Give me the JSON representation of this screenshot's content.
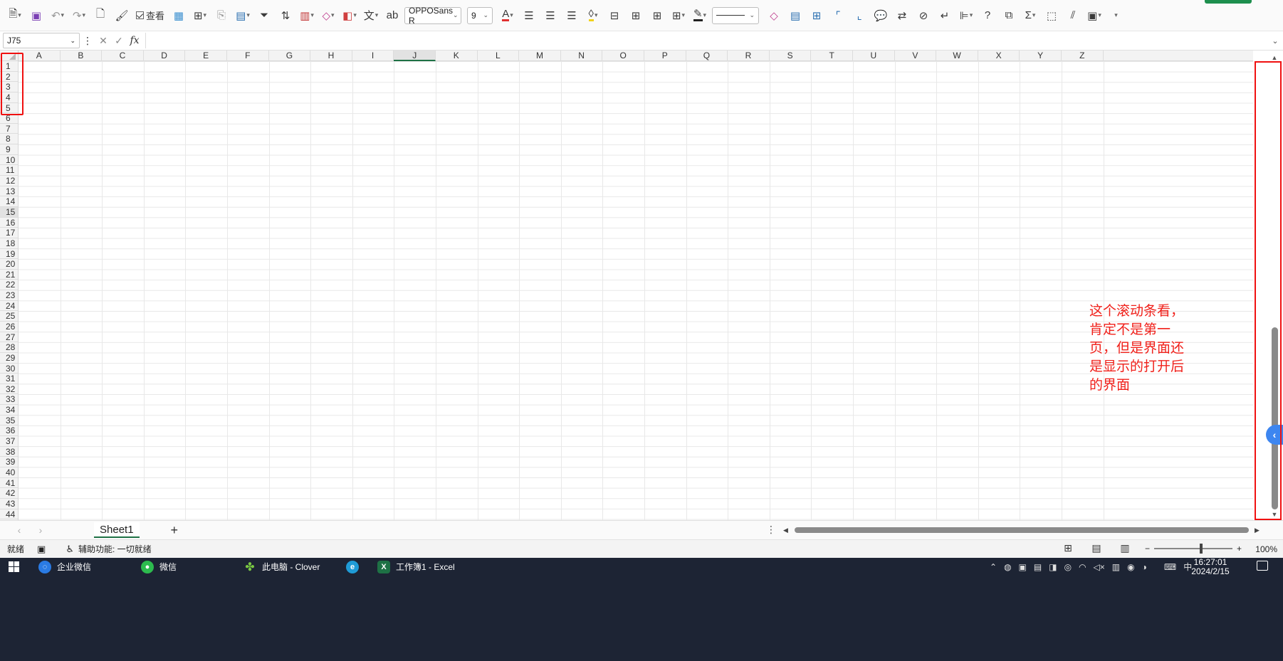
{
  "toolbar": {
    "check_view_label": "查看",
    "font_name": "OPPOSans R",
    "font_size": "9"
  },
  "formula_bar": {
    "name_box": "J75",
    "fx_label": "fx",
    "formula": ""
  },
  "grid": {
    "columns": [
      "A",
      "B",
      "C",
      "D",
      "E",
      "F",
      "G",
      "H",
      "I",
      "J",
      "K",
      "L",
      "M",
      "N",
      "O",
      "P",
      "Q",
      "R",
      "S",
      "T",
      "U",
      "V",
      "W",
      "X",
      "Y",
      "Z"
    ],
    "active_column": "J",
    "rows": [
      "1",
      "2",
      "3",
      "4",
      "5",
      "6",
      "7",
      "8",
      "9",
      "10",
      "11",
      "12",
      "13",
      "14",
      "15",
      "16",
      "17",
      "18",
      "19",
      "20",
      "21",
      "22",
      "23",
      "24",
      "25",
      "26",
      "27",
      "28",
      "29",
      "30",
      "31",
      "32",
      "33",
      "34",
      "35",
      "36",
      "37",
      "38",
      "39",
      "40",
      "41",
      "42",
      "43",
      "44"
    ],
    "active_row": "15"
  },
  "annotation": {
    "note_lines": [
      "这个滚动条看，",
      "肯定不是第一",
      "页，但是界面还",
      "是显示的打开后",
      "的界面"
    ],
    "color": "#f01010"
  },
  "sheets": {
    "tabs": [
      "Sheet1"
    ],
    "active": "Sheet1",
    "add_label": "+"
  },
  "status": {
    "ready": "就绪",
    "accessibility": "辅助功能: 一切就绪",
    "zoom_minus": "−",
    "zoom_plus": "+",
    "zoom_value": "100%"
  },
  "taskbar": {
    "apps": [
      {
        "label": "企业微信"
      },
      {
        "label": "微信"
      },
      {
        "label": "此电脑 - Clover"
      },
      {
        "label": ""
      },
      {
        "label": "工作簿1 - Excel"
      }
    ],
    "ime": "中",
    "time": "16:27:01",
    "date": "2024/2/15"
  },
  "colors": {
    "excel_green": "#1e7145",
    "annotation_red": "#f01010",
    "taskbar_bg": "#1d2434"
  }
}
